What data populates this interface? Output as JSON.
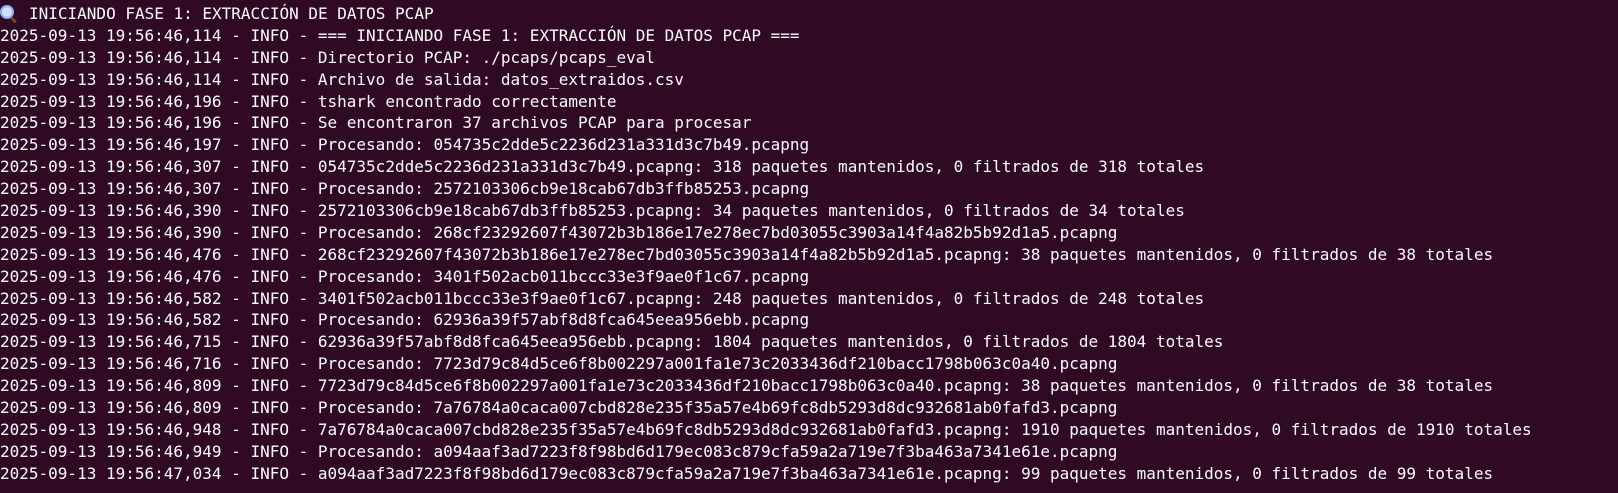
{
  "terminal": {
    "background": "#300a24",
    "foreground": "#ffffff",
    "header": {
      "icon": "magnifying-glass-icon",
      "text": "INICIANDO FASE 1: EXTRACCIÓN DE DATOS PCAP"
    },
    "log_lines": [
      "2025-09-13 19:56:46,114 - INFO - === INICIANDO FASE 1: EXTRACCIÓN DE DATOS PCAP ===",
      "2025-09-13 19:56:46,114 - INFO - Directorio PCAP: ./pcaps/pcaps_eval",
      "2025-09-13 19:56:46,114 - INFO - Archivo de salida: datos_extraidos.csv",
      "2025-09-13 19:56:46,196 - INFO - tshark encontrado correctamente",
      "2025-09-13 19:56:46,196 - INFO - Se encontraron 37 archivos PCAP para procesar",
      "2025-09-13 19:56:46,197 - INFO - Procesando: 054735c2dde5c2236d231a331d3c7b49.pcapng",
      "2025-09-13 19:56:46,307 - INFO - 054735c2dde5c2236d231a331d3c7b49.pcapng: 318 paquetes mantenidos, 0 filtrados de 318 totales",
      "2025-09-13 19:56:46,307 - INFO - Procesando: 2572103306cb9e18cab67db3ffb85253.pcapng",
      "2025-09-13 19:56:46,390 - INFO - 2572103306cb9e18cab67db3ffb85253.pcapng: 34 paquetes mantenidos, 0 filtrados de 34 totales",
      "2025-09-13 19:56:46,390 - INFO - Procesando: 268cf23292607f43072b3b186e17e278ec7bd03055c3903a14f4a82b5b92d1a5.pcapng",
      "2025-09-13 19:56:46,476 - INFO - 268cf23292607f43072b3b186e17e278ec7bd03055c3903a14f4a82b5b92d1a5.pcapng: 38 paquetes mantenidos, 0 filtrados de 38 totales",
      "2025-09-13 19:56:46,476 - INFO - Procesando: 3401f502acb011bccc33e3f9ae0f1c67.pcapng",
      "2025-09-13 19:56:46,582 - INFO - 3401f502acb011bccc33e3f9ae0f1c67.pcapng: 248 paquetes mantenidos, 0 filtrados de 248 totales",
      "2025-09-13 19:56:46,582 - INFO - Procesando: 62936a39f57abf8d8fca645eea956ebb.pcapng",
      "2025-09-13 19:56:46,715 - INFO - 62936a39f57abf8d8fca645eea956ebb.pcapng: 1804 paquetes mantenidos, 0 filtrados de 1804 totales",
      "2025-09-13 19:56:46,716 - INFO - Procesando: 7723d79c84d5ce6f8b002297a001fa1e73c2033436df210bacc1798b063c0a40.pcapng",
      "2025-09-13 19:56:46,809 - INFO - 7723d79c84d5ce6f8b002297a001fa1e73c2033436df210bacc1798b063c0a40.pcapng: 38 paquetes mantenidos, 0 filtrados de 38 totales",
      "2025-09-13 19:56:46,809 - INFO - Procesando: 7a76784a0caca007cbd828e235f35a57e4b69fc8db5293d8dc932681ab0fafd3.pcapng",
      "2025-09-13 19:56:46,948 - INFO - 7a76784a0caca007cbd828e235f35a57e4b69fc8db5293d8dc932681ab0fafd3.pcapng: 1910 paquetes mantenidos, 0 filtrados de 1910 totales",
      "2025-09-13 19:56:46,949 - INFO - Procesando: a094aaf3ad7223f8f98bd6d179ec083c879cfa59a2a719e7f3ba463a7341e61e.pcapng",
      "2025-09-13 19:56:47,034 - INFO - a094aaf3ad7223f8f98bd6d179ec083c879cfa59a2a719e7f3ba463a7341e61e.pcapng: 99 paquetes mantenidos, 0 filtrados de 99 totales"
    ]
  }
}
